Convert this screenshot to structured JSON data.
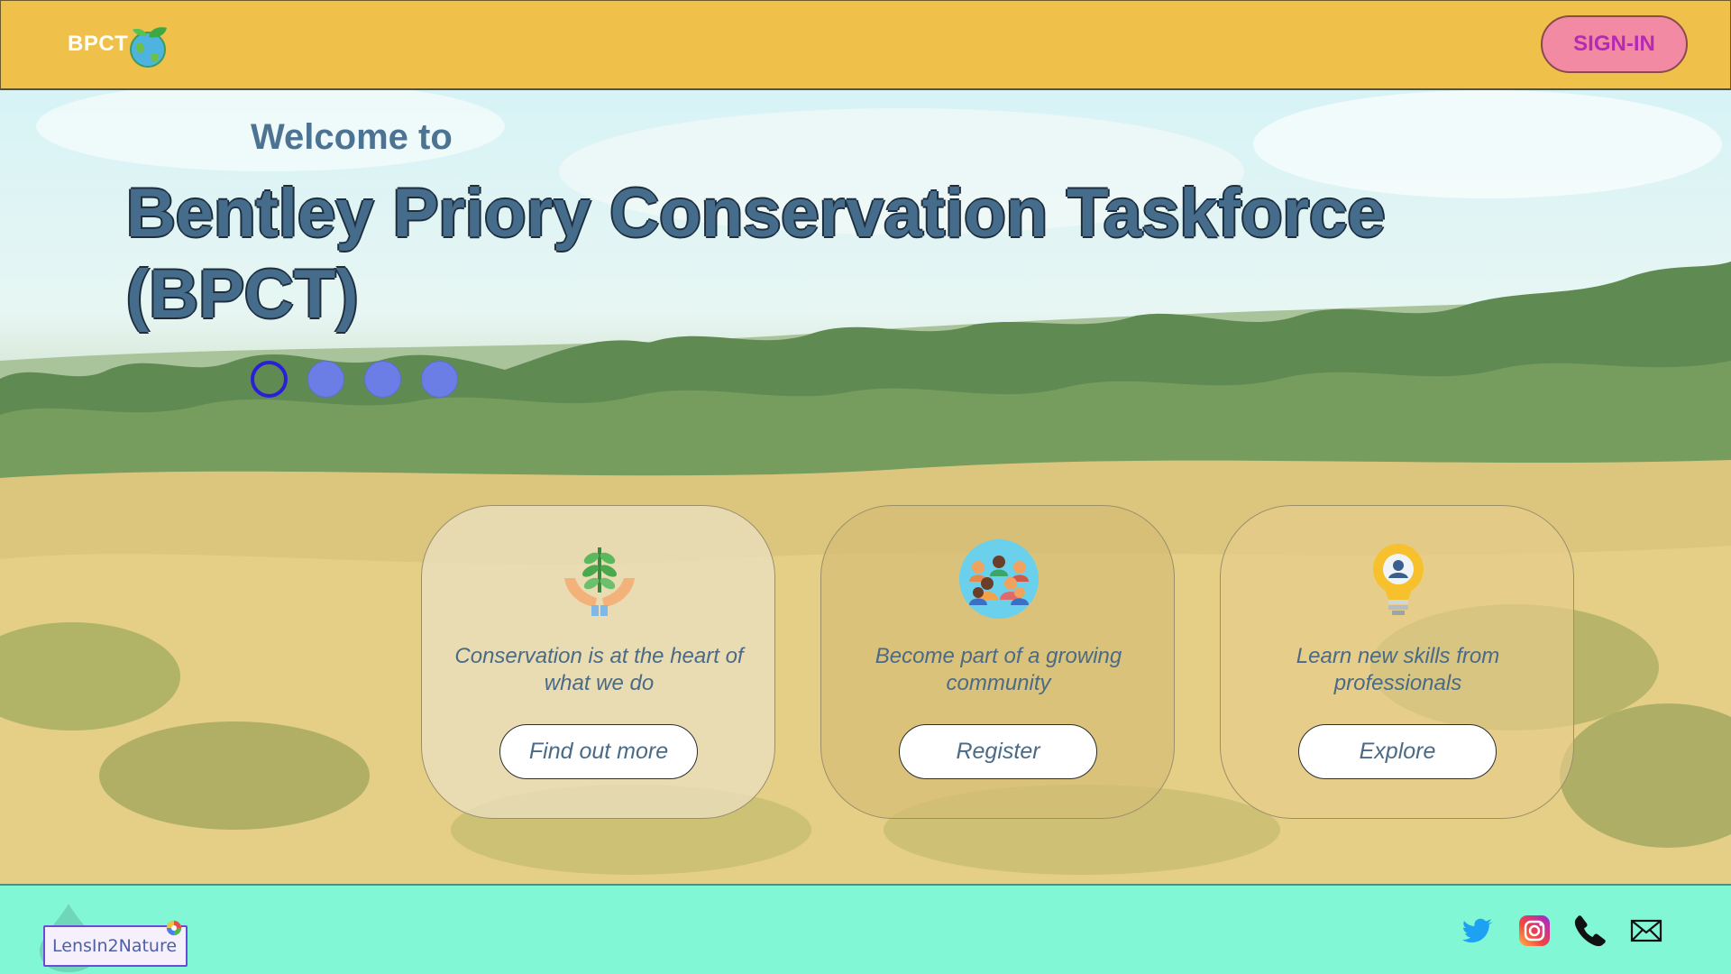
{
  "header": {
    "logo_text": "BPCT",
    "signin_label": "SIGN-IN"
  },
  "hero": {
    "welcome": "Welcome to",
    "title": "Bentley Priory Conservation Taskforce (BPCT)",
    "carousel": {
      "count": 4,
      "active_index": 0
    }
  },
  "cards": [
    {
      "icon": "hands-plant-icon",
      "description": "Conservation is at the heart of what we do",
      "button": "Find out more"
    },
    {
      "icon": "community-group-icon",
      "description": "Become part of a growing community",
      "button": "Register"
    },
    {
      "icon": "lightbulb-person-icon",
      "description": "Learn new skills from professionals",
      "button": "Explore"
    }
  ],
  "footer": {
    "brand": "LensIn2Nature",
    "social": [
      "twitter-icon",
      "instagram-icon",
      "phone-icon",
      "email-icon"
    ]
  },
  "colors": {
    "header_bg": "#efc14b",
    "signin_bg": "#f28aa3",
    "signin_text": "#b52ab5",
    "title_text": "#466c8c",
    "dot": "#6a7ee5",
    "dot_active": "#2a1fd9",
    "footer_bg": "#82f7d6"
  }
}
